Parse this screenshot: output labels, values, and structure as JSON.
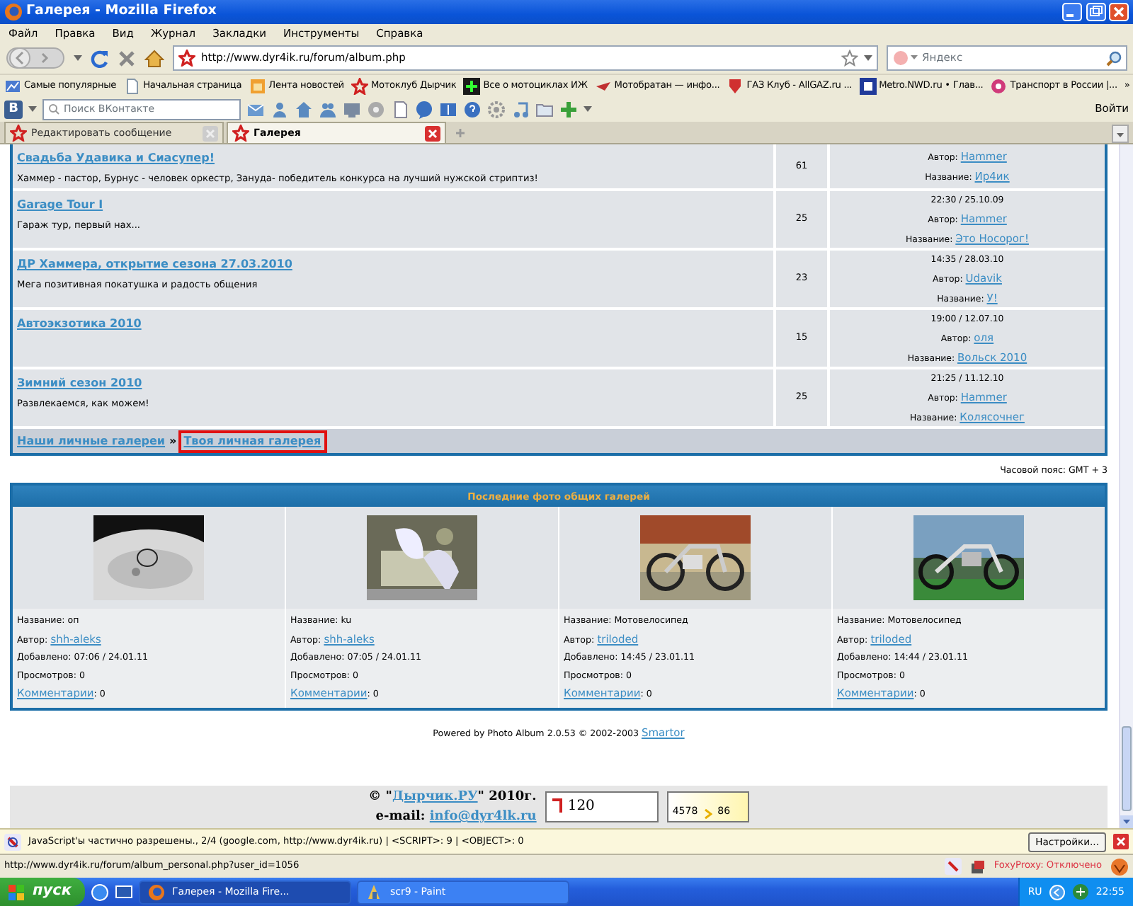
{
  "window": {
    "title": "Галерея - Mozilla Firefox"
  },
  "menu": [
    "Файл",
    "Правка",
    "Вид",
    "Журнал",
    "Закладки",
    "Инструменты",
    "Справка"
  ],
  "nav": {
    "url": "http://www.dyr4ik.ru/forum/album.php",
    "search_placeholder": "Яндекс"
  },
  "bookmarks": [
    "Самые популярные",
    "Начальная страница",
    "Лента новостей",
    "Мотоклуб Дырчик",
    "Все о мотоциклах ИЖ",
    "Мотобратан — инфо...",
    "ГАЗ Клуб - AllGAZ.ru ...",
    "Metro.NWD.ru • Глав...",
    "Транспорт в России |..."
  ],
  "bookmarks_more": "»",
  "vk_toolbar": {
    "logo": "В",
    "search_placeholder": "Поиск ВКонтакте",
    "login": "Войти"
  },
  "tabs": [
    {
      "label": "Редактировать сообщение",
      "selected": false
    },
    {
      "label": "Галерея",
      "selected": true
    }
  ],
  "galleries": [
    {
      "title": "Свадьба Удавика и Сиасупер!",
      "description": "Хаммер - пастор, Бурнус - человек оркестр, Зануда- победитель конкурса на лучший нужской стриптиз!",
      "count": "61",
      "author_label": "Автор:",
      "author": "Hammer",
      "photo_label": "Название:",
      "photo": "Ир4ик"
    },
    {
      "title": "Garage Tour I",
      "description": "Гараж тур, первый нах...",
      "count": "25",
      "date": "22:30 / 25.10.09",
      "author_label": "Автор:",
      "author": "Hammer",
      "photo_label": "Название:",
      "photo": "Это Носорог!"
    },
    {
      "title": "ДР Хаммера, открытие сезона 27.03.2010",
      "description": "Мега позитивная покатушка и радость общения",
      "count": "23",
      "date": "14:35 / 28.03.10",
      "author_label": "Автор:",
      "author": "Udavik",
      "photo_label": "Название:",
      "photo": "У!"
    },
    {
      "title": "Автоэкзотика 2010",
      "count": "15",
      "date": "19:00 / 12.07.10",
      "author_label": "Автор:",
      "author": "оля",
      "photo_label": "Название:",
      "photo": "Вольск 2010"
    },
    {
      "title": "Зимний сезон 2010",
      "description": "Развлекаемся, как можем!",
      "count": "25",
      "date": "21:25 / 11.12.10",
      "author_label": "Автор:",
      "author": "Hammer",
      "photo_label": "Название:",
      "photo": "Колясочнег"
    }
  ],
  "breadcrumb": [
    {
      "label": "Наши личные галереи",
      "highlighted": false
    },
    {
      "label": "Твоя личная галерея",
      "highlighted": true
    }
  ],
  "breadcrumb_separator": "»",
  "timezone": "Часовой пояс: GMT + 3",
  "latest": {
    "title": "Последние фото общих галерей",
    "photos": [
      {
        "kind": "picture",
        "name": "Название: оп",
        "author_label": "Автор:",
        "author": "shh-aleks",
        "added": "Добавлено: 07:06 / 24.01.11",
        "views": "Просмотров: 0",
        "comments_link": "Комментарии",
        "comments": ": 0"
      },
      {
        "kind": "picture",
        "name": "Название: ku",
        "author_label": "Автор:",
        "author": "shh-aleks",
        "added": "Добавлено: 07:05 / 24.01.11",
        "views": "Просмотров: 0",
        "comments_link": "Комментарии",
        "comments": ": 0"
      },
      {
        "kind": "picture",
        "name": "Название: Мотовелосипед",
        "author_label": "Автор:",
        "author": "triloded",
        "added": "Добавлено: 14:45 / 23.01.11",
        "views": "Просмотров: 0",
        "comments_link": "Комментарии",
        "comments": ": 0"
      },
      {
        "kind": "picture",
        "name": "Название: Мотовелосипед",
        "author_label": "Автор:",
        "author": "triloded",
        "added": "Добавлено: 14:44 / 23.01.11",
        "views": "Просмотров: 0",
        "comments_link": "Комментарии",
        "comments": ": 0"
      }
    ]
  },
  "powered": {
    "text": "Powered by Photo Album 2.0.53 © 2002-2003",
    "link": "Smartor"
  },
  "footer": {
    "copyright_prefix": "© \"",
    "site_link": "Дырчик.РУ",
    "copyright_suffix": "\" 2010г.",
    "email_label": "e-mail:",
    "email": "info@dyr4lk.ru",
    "counter": "120",
    "counter2_values": [
      "4578",
      "86"
    ]
  },
  "noscript_bar": {
    "message": "JavaScript'ы частично разрешены., 2/4 (google.com, http://www.dyr4ik.ru) | <SCRIPT>: 9 | <OBJECT>: 0",
    "button": "Настройки..."
  },
  "status_bar": {
    "url": "http://www.dyr4ik.ru/forum/album_personal.php?user_id=1056",
    "proxy": "FoxyProxy: Отключено"
  },
  "taskbar": {
    "start": "пуск",
    "tasks": [
      {
        "label": "Галерея - Mozilla Fire...",
        "selected": true
      },
      {
        "label": "scr9 - Paint",
        "selected": false
      }
    ],
    "language": "RU",
    "clock": "22:55"
  }
}
